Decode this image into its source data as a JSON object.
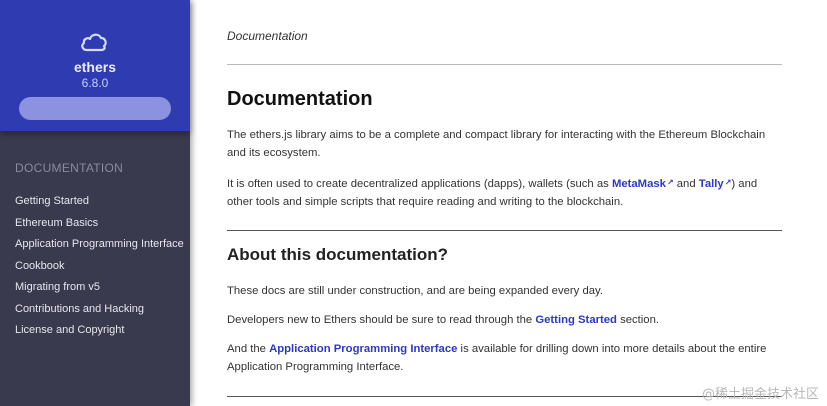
{
  "sidebar": {
    "brand": {
      "name": "ethers",
      "version": "6.8.0",
      "icon": "cloud-icon"
    },
    "search": {
      "placeholder": ""
    },
    "section_title": "DOCUMENTATION",
    "items": [
      {
        "label": "Getting Started"
      },
      {
        "label": "Ethereum Basics"
      },
      {
        "label": "Application Programming Interface"
      },
      {
        "label": "Cookbook"
      },
      {
        "label": "Migrating from v5"
      },
      {
        "label": "Contributions and Hacking"
      },
      {
        "label": "License and Copyright"
      }
    ]
  },
  "main": {
    "breadcrumb": "Documentation",
    "title": "Documentation",
    "intro": {
      "p1": "The ethers.js library aims to be a complete and compact library for interacting with the Ethereum Blockchain and its ecosystem.",
      "p2_before": "It is often used to create decentralized applications (dapps), wallets (such as ",
      "link_metamask": "MetaMask",
      "p2_and": " and ",
      "link_tally": "Tally",
      "p2_after": ") and other tools and simple scripts that require reading and writing to the blockchain."
    },
    "about": {
      "heading": "About this documentation?",
      "p1": "These docs are still under construction, and are being expanded every day.",
      "p2_before": "Developers new to Ethers should be sure to read through the ",
      "link_getting_started": "Getting Started",
      "p2_after": " section.",
      "p3_before": "And the ",
      "link_api": "Application Programming Interface",
      "p3_after": " is available for drilling down into more details about the entire Application Programming Interface."
    },
    "external_link_glyph": "↗"
  },
  "watermark": "@稀土掘金技术社区",
  "colors": {
    "sidebar_header": "#2f3bb0",
    "sidebar_body": "#3a3a4e",
    "link": "#2b39c4"
  }
}
